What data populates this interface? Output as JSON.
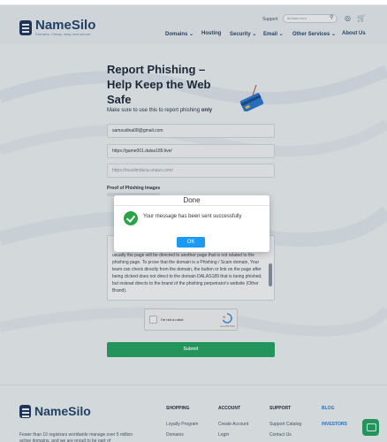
{
  "header": {
    "logo_name": "NameSilo",
    "logo_tagline": "Domains. Cheap, easy, and secure.",
    "support_label": "Support",
    "search_placeholder": "domain.com",
    "nav": [
      "Domains",
      "Hosting",
      "Security",
      "Email",
      "Other Services",
      "About Us"
    ]
  },
  "form": {
    "title": "Report Phishing – Help Keep the Web Safe",
    "subtitle_prefix": "Make sure to use this to report phishing",
    "subtitle_bold": "only",
    "email_value": "samsudina08@gmail.com",
    "url_value": "https://game001.dalas189.live/",
    "brand_url_placeholder": "https://muslimduca.unaux.com/",
    "proof_label": "Proof of Phishing Images",
    "description_text": "usually the page will be directed to another page that is not related to the phishing page. To prove that the domain is a Phishing / Scam domain, Your team can check directly from the domain, the button or link on the page after being clicked does not direct to the domain DALAS189 that is being phished, but instead directs to the brand of the phishing perpetrator's website (Other Brand).",
    "recaptcha_label": "I'm not a robot",
    "recaptcha_brand": "reCAPTCHA",
    "submit_label": "Submit"
  },
  "dialog": {
    "title": "Done",
    "message": "Your message has been sent successfully",
    "ok_label": "OK"
  },
  "footer": {
    "logo_name": "NameSilo",
    "description": "Fewer than 10 registrars worldwide manage over 5 million active domains, and we are proud to be part of",
    "columns": [
      {
        "heading": "SHOPPING",
        "links": [
          "Loyalty Program",
          "Domains"
        ]
      },
      {
        "heading": "ACCOUNT",
        "links": [
          "Create Account",
          "Login"
        ]
      },
      {
        "heading": "SUPPORT",
        "links": [
          "Support Catalog",
          "Contact Us"
        ]
      },
      {
        "heading": "BLOG",
        "links": [
          "INVESTORS"
        ]
      }
    ]
  },
  "colors": {
    "accent_green": "#27a866",
    "brand_navy": "#24476e",
    "ok_blue": "#1a99f5"
  }
}
